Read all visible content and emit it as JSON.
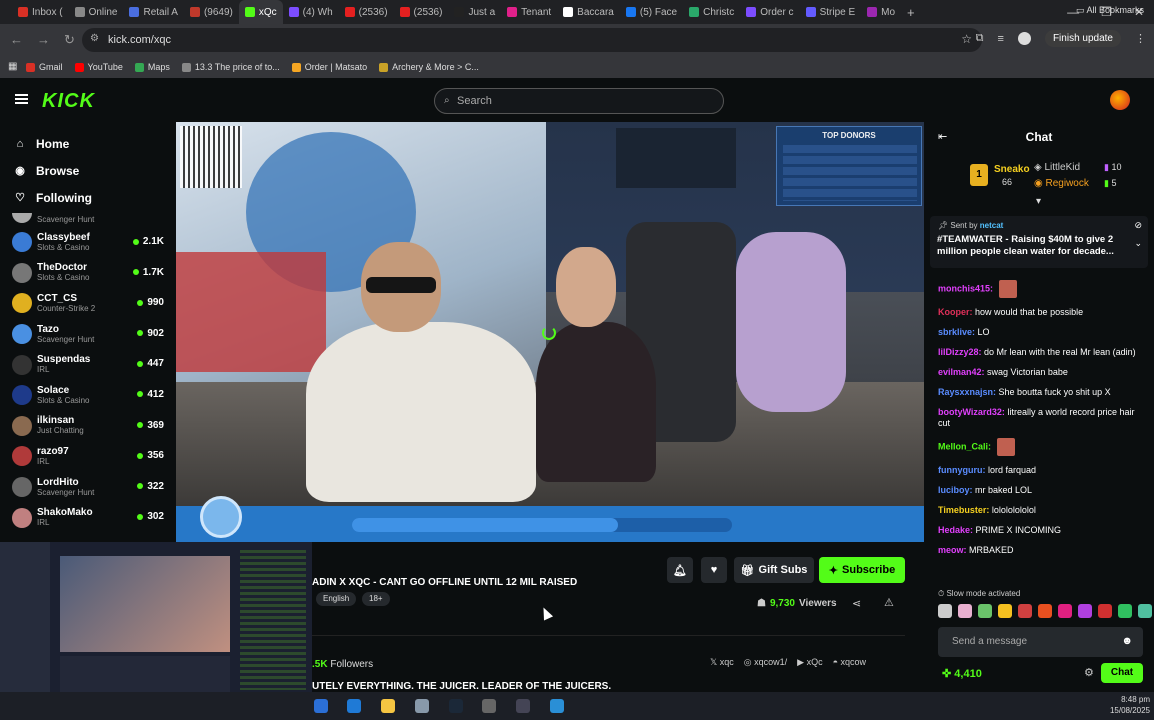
{
  "browser": {
    "tabs": [
      {
        "label": "Inbox (",
        "color": "#d93025"
      },
      {
        "label": "Online",
        "color": "#888888"
      },
      {
        "label": "Retail A",
        "color": "#4a6ee0"
      },
      {
        "label": "(9649)",
        "color": "#c0392b"
      },
      {
        "label": "xQc",
        "color": "#53fc18"
      },
      {
        "label": "(4) Wh",
        "color": "#7c4dff"
      },
      {
        "label": "(2536)",
        "color": "#e52020"
      },
      {
        "label": "(2536)",
        "color": "#e52020"
      },
      {
        "label": "Just a",
        "color": "#222222"
      },
      {
        "label": "Tenant",
        "color": "#e0208a"
      },
      {
        "label": "Baccara",
        "color": "#ffffff"
      },
      {
        "label": "(5) Face",
        "color": "#1877f2"
      },
      {
        "label": "Christc",
        "color": "#2aa86a"
      },
      {
        "label": "Order c",
        "color": "#7c4dff"
      },
      {
        "label": "Stripe E",
        "color": "#635bff"
      },
      {
        "label": "Mo",
        "color": "#9c27b0"
      }
    ],
    "url": "kick.com/xqc",
    "finish_update": "Finish update",
    "bookmarks": [
      {
        "label": "Gmail",
        "color": "#d93025"
      },
      {
        "label": "YouTube",
        "color": "#ff0000"
      },
      {
        "label": "Maps",
        "color": "#34a853"
      },
      {
        "label": "13.3 The price of to...",
        "color": "#888888"
      },
      {
        "label": "Order | Matsato",
        "color": "#f5a623"
      },
      {
        "label": "Archery & More > C...",
        "color": "#c9a227"
      }
    ],
    "all_bookmarks": "All Bookmarks"
  },
  "header": {
    "logo": "KICK",
    "search_placeholder": "Search"
  },
  "sidebar": {
    "nav": [
      {
        "label": "Home",
        "icon": "⌂"
      },
      {
        "label": "Browse",
        "icon": "◉"
      },
      {
        "label": "Following",
        "icon": "♡"
      }
    ],
    "top_partial": {
      "category": "Scavenger Hunt"
    },
    "channels": [
      {
        "name": "Classybeef",
        "category": "Slots & Casino",
        "viewers": "2.1K",
        "color": "#3a7bd5"
      },
      {
        "name": "TheDoctor",
        "category": "Slots & Casino",
        "viewers": "1.7K",
        "color": "#777777"
      },
      {
        "name": "CCT_CS",
        "category": "Counter-Strike 2",
        "viewers": "990",
        "color": "#e0b020"
      },
      {
        "name": "Tazo",
        "category": "Scavenger Hunt",
        "viewers": "902",
        "color": "#4a90e2"
      },
      {
        "name": "Suspendas",
        "category": "IRL",
        "viewers": "447",
        "color": "#333333"
      },
      {
        "name": "Solace",
        "category": "Slots & Casino",
        "viewers": "412",
        "color": "#1e3a8a"
      },
      {
        "name": "ilkinsan",
        "category": "Just Chatting",
        "viewers": "369",
        "color": "#8a6a50"
      },
      {
        "name": "razo97",
        "category": "IRL",
        "viewers": "356",
        "color": "#b03a3a"
      },
      {
        "name": "LordHito",
        "category": "Scavenger Hunt",
        "viewers": "322",
        "color": "#666666"
      },
      {
        "name": "ShakoMako",
        "category": "IRL",
        "viewers": "302",
        "color": "#c08080"
      }
    ]
  },
  "video": {
    "donors_title": "TOP DONORS",
    "raised_progress": 0.7
  },
  "stream": {
    "title": "ADIN X XQC - CANT GO OFFLINE UNTIL 12 MIL RAISED",
    "tags": [
      "English",
      "18+"
    ],
    "gift_subs": "Gift Subs",
    "subscribe": "Subscribe",
    "viewers": "9,730",
    "viewers_label": "Viewers",
    "followers": ".5K",
    "followers_label": "Followers",
    "socials": [
      "xqc",
      "xqcow1/",
      "xQc",
      "xqcow"
    ],
    "bio": "UTELY EVERYTHING. THE JUICER. LEADER OF THE JUICERS."
  },
  "chat": {
    "title": "Chat",
    "leaders": [
      {
        "name": "Sneako",
        "count": "66",
        "rank": "1"
      },
      {
        "name": "LittleKid",
        "count": "10"
      },
      {
        "name": "Regiwock",
        "count": "5"
      }
    ],
    "pinned_sender": "Sent by",
    "pinned_user": "netcat",
    "pinned_text": "#TEAMWATER - Raising $40M to give 2 million people clean water for decade...",
    "messages": [
      {
        "user": "monchis415:",
        "text": "",
        "color": "#e040fb"
      },
      {
        "user": "Kooper:",
        "text": "how would that be possible",
        "color": "#e0305a"
      },
      {
        "user": "sbrklive:",
        "text": "LO",
        "color": "#5a8cff"
      },
      {
        "user": "lilDizzy28:",
        "text": "do Mr lean with the real Mr lean (adin)",
        "color": "#e040fb"
      },
      {
        "user": "evilman42:",
        "text": "swag Victorian babe",
        "color": "#e040fb"
      },
      {
        "user": "Raysxxnajsn:",
        "text": "She boutta fuck yo shit up X",
        "color": "#5a8cff"
      },
      {
        "user": "bootyWizard32:",
        "text": "litreally a world record price hair cut",
        "color": "#e040fb"
      },
      {
        "user": "Mellon_Cali:",
        "text": "",
        "color": "#53fc18"
      },
      {
        "user": "funnyguru:",
        "text": "lord farquad",
        "color": "#5a8cff"
      },
      {
        "user": "luciboy:",
        "text": "mr baked LOL",
        "color": "#5a8cff"
      },
      {
        "user": "Timebuster:",
        "text": "lolololololol",
        "color": "#f5d020"
      },
      {
        "user": "Hedake:",
        "text": "PRIME X INCOMING",
        "color": "#e040fb"
      },
      {
        "user": "meow:",
        "text": "MRBAKED",
        "color": "#e040fb"
      }
    ],
    "slow_mode": "Slow mode activated",
    "input_placeholder": "Send a message",
    "points": "4,410",
    "chat_button": "Chat"
  },
  "taskbar": {
    "time": "8:48 pm",
    "date": "15/08/2025"
  }
}
